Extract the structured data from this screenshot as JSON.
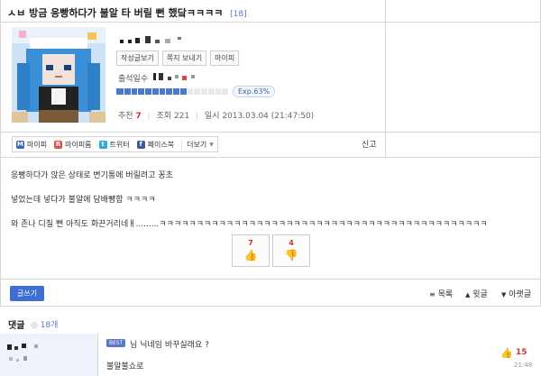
{
  "post": {
    "title": "ㅅㅂ 방금 응빵하다가 불알 타 버릴 뻔 했닼ㅋㅋㅋㅋ",
    "reply_count": "[18]"
  },
  "author": {
    "buttons": [
      "작성글보기",
      "쪽지 보내기",
      "마이피"
    ],
    "attendance_label": "출석일수",
    "exp_label": "Exp.63%",
    "exp_progress": 0.63
  },
  "meta": {
    "recommend_label": "추천",
    "recommend_value": "7",
    "views_label": "조회",
    "views_value": "221",
    "date_label": "일시",
    "date_value": "2013.03.04 (21:47:50)"
  },
  "share": {
    "items": [
      {
        "label": "마이피",
        "icon": "mypi-icon",
        "color": "#3b63c4"
      },
      {
        "label": "마이피룸",
        "icon": "mypiroom-icon",
        "color": "#d9534f"
      },
      {
        "label": "트위터",
        "icon": "twitter-icon",
        "color": "#29a9e1"
      },
      {
        "label": "페이스북",
        "icon": "facebook-icon",
        "color": "#3b5998"
      }
    ],
    "more_label": "더보기",
    "report_label": "신고"
  },
  "body": {
    "lines": [
      "응빵하다가 앉은 상태로 변기통에 버릴려고 꽁초",
      "넣었는데 넣다가 불알에 담배빵함 ㅋㅋㅋㅋ",
      "와 존나 디질 뻔 아직도 화끈거리네ㅐ.........ㅋㅋㅋㅋㅋㅋㅋㅋㅋㅋㅋㅋㅋㅋㅋㅋㅋㅋㅋㅋㅋㅋㅋㅋㅋㅋㅋㅋㅋㅋㅋㅋㅋㅋㅋㅋㅋㅋㅋㅋㅋㅋㅋㅋ"
    ],
    "vote_up": "7",
    "vote_down": "4"
  },
  "footer": {
    "write_label": "글쓰기",
    "list_label": "목록",
    "prev_label": "윗글",
    "next_label": "아랫글"
  },
  "comments": {
    "heading": "댓글",
    "count": "18개",
    "items": [
      {
        "badge": "BEST",
        "line1": "님 닉네임 바꾸실래요 ?",
        "line2": "불알불쇼로",
        "likes": "15",
        "time": "21:48"
      }
    ]
  }
}
